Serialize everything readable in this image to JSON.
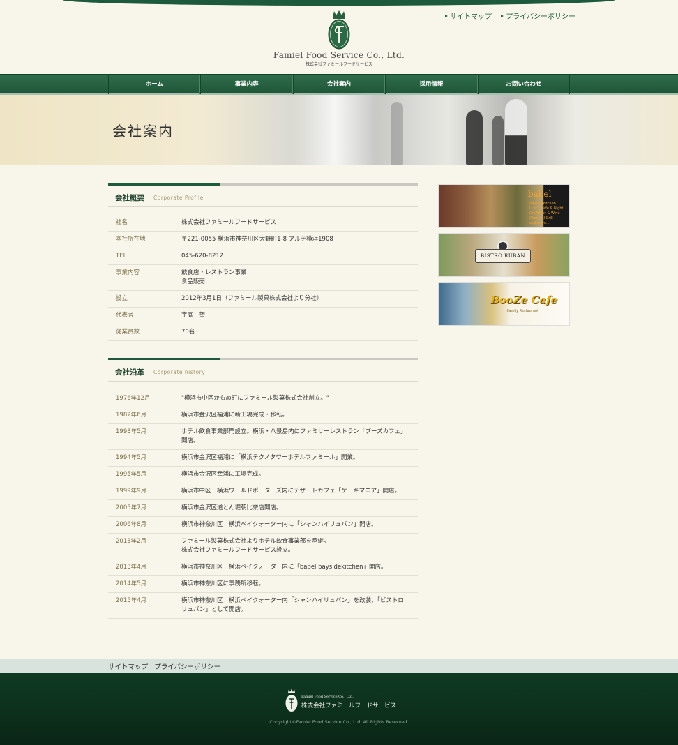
{
  "header": {
    "logo_en": "Famiel Food Service Co., Ltd.",
    "logo_jp": "株式会社ファミールフードサービス",
    "top_links": [
      "サイトマップ",
      "プライバシーポリシー"
    ]
  },
  "nav": {
    "items": [
      "ホーム",
      "事業内容",
      "会社案内",
      "採用情報",
      "お問い合わせ"
    ]
  },
  "hero": {
    "title": "会社案内"
  },
  "profile": {
    "title": "会社概要",
    "subtitle": "Corporate Profile",
    "rows": [
      {
        "k": "社名",
        "v": "株式会社ファミールフードサービス"
      },
      {
        "k": "本社所在地",
        "v": "〒221-0055 横浜市神奈川区大野町1-8 アルテ横浜1908"
      },
      {
        "k": "TEL",
        "v": "045-620-8212"
      },
      {
        "k": "事業内容",
        "v": "飲食店・レストラン事業\n食品販売"
      },
      {
        "k": "設立",
        "v": "2012年3月1日（ファミール製菓株式会社より分社）"
      },
      {
        "k": "代表者",
        "v": "宇髙　望"
      },
      {
        "k": "従業員数",
        "v": "70名"
      }
    ]
  },
  "history": {
    "title": "会社沿革",
    "subtitle": "Corporate history",
    "rows": [
      {
        "k": "1976年12月",
        "v": "\"横浜市中区かもめ町にファミール製菓株式会社創立。\""
      },
      {
        "k": "1982年6月",
        "v": "横浜市金沢区福浦に新工場完成・移転。"
      },
      {
        "k": "1993年5月",
        "v": "ホテル飲食事業部門設立。横浜・八景島内にファミリーレストラン「ブーズカフェ」開店。"
      },
      {
        "k": "1994年5月",
        "v": "横浜市金沢区福浦に「横浜テクノタワーホテルファミール」開業。"
      },
      {
        "k": "1995年5月",
        "v": "横浜市金沢区幸浦に工場完成。"
      },
      {
        "k": "1999年9月",
        "v": "横浜市中区　横浜ワールドポーターズ内にデザートカフェ「ケーキマニア」開店。"
      },
      {
        "k": "2005年7月",
        "v": "横浜市金沢区道とん堀朝比奈店開店。"
      },
      {
        "k": "2006年8月",
        "v": "横浜市神奈川区　横浜ベイクォーター内に「シャンハイリュバン」開店。"
      },
      {
        "k": "2013年2月",
        "v": "ファミール製菓株式会社よりホテル飲食事業部を承継。\n株式会社ファミールフードサービス設立。"
      },
      {
        "k": "2013年4月",
        "v": "横浜市神奈川区　横浜ベイクォーター内に「babel baysidekitchen」開店。"
      },
      {
        "k": "2014年5月",
        "v": "横浜市神奈川区に事務所移転。"
      },
      {
        "k": "2015年4月",
        "v": "横浜市神奈川区　横浜ベイクォーター内「シャンハイリュバン」を改装、「ビストロリュバン」として開店。"
      }
    ]
  },
  "banners": {
    "babel": {
      "logo": "babel",
      "sub": "baysidekitchen\nLunch Cafe & Night\nCraftBeer & Wine\nCharcoal Grill\nand more..."
    },
    "bistro": {
      "logo": "BISTRO RUBAN"
    },
    "booze": {
      "logo": "BooZe Cafe",
      "sub": "Family Restaurant"
    }
  },
  "footer": {
    "links": "サイトマップ | プライバシーポリシー",
    "en": "Famiel Food Service Co., Ltd.",
    "jp": "株式会社ファミールフードサービス",
    "copyright": "Copyright©Famiel Food Service Co., Ltd. All Rights Reserved."
  },
  "colors": {
    "brand_green": "#1d5a3b",
    "bg": "#f8f6ea"
  }
}
